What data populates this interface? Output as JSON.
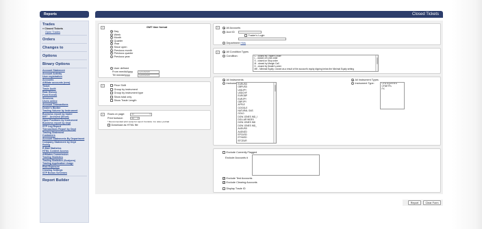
{
  "sidebar": {
    "header": "Reports",
    "trades": {
      "title": "Trades",
      "closed": "Closed Tickets",
      "open": "Open Trades"
    },
    "sections": [
      "Orders",
      "Changes to",
      "Options",
      "Binary Options"
    ],
    "items": [
      "Account Statement",
      "Account Activity",
      "User registration",
      "Accounts",
      "Affiliate accounts (new)",
      "Ticket",
      "Trade Audit",
      "Rate History",
      "Feed Events",
      "Sessions",
      "Users online",
      "Account Transactions",
      "Dealer's Blotter",
      "Trading Volume by Instrument",
      "Business report by trader",
      "BRT - Archived (Short)",
      "Open Positions by Instrument",
      "Business report by dept",
      "STP Log Report",
      "Transactions Report by Dept",
      "Trading Statement",
      "Customers",
      "Account Statements By Department",
      "Company Statement by Dept",
      "Rating",
      "E-Mail Statistics",
      "HTML Content Access",
      "Affiliates Commission",
      "Trading Statistics",
      "Trading Statistics (Scalpers)",
      "Trading Application Usage",
      "Risk Exposure",
      "Clearing Settings",
      "STP Bonus Schemes"
    ],
    "footer_section": "Report Builder"
  },
  "title": "Closed Tickets",
  "time_panel": {
    "heading": "GMT time format",
    "options": [
      "Day",
      "Week",
      "Month",
      "Quarter",
      "Year",
      "Since open",
      "Previous month",
      "Previous quarter",
      "Previous year"
    ],
    "user_defined": "User defined",
    "from_label": "From mm/dd/yyyy",
    "from_value": "12/13/2020",
    "till_label": "Till mm/dd/yyyy",
    "till_value": "12/20/2020"
  },
  "group_panel": {
    "options": [
      "Price Shift",
      "Group by instrument",
      "Group by instrument type",
      "Show total only",
      "Show Trade Length"
    ]
  },
  "rows_panel": {
    "rows_label": "Rows on page:",
    "rows_value": "30",
    "font_label": "Print fontsize:",
    "font_value": "30",
    "note": "* Recommended print setup for report: Fontsize: 12, letter, portrait",
    "download": "Download as HTML file"
  },
  "accounts_panel": {
    "all": "All Accounts",
    "acct_id": "Acct ID",
    "trader_login": "Trader's Login",
    "department": "Department",
    "department_link": "Hlds"
  },
  "condition_panel": {
    "all": "All Condition Types",
    "condition": "Condition:",
    "items": [
      "C - closed by Trader's order",
      "L - closed on Limit order",
      "S - closed on Stop order",
      "M - closed by Margin Call",
      "D - closed by Dealer's order",
      "ME - Minimal Equity. Closed as a result of the account's equity dipping below the Minimal Equity setting"
    ]
  },
  "instrument_panel": {
    "all": "All Instruments",
    "instrument": "Instrument:",
    "items": [
      "EURUSD",
      "GBPUSD",
      "USDJPY",
      "USDCHF",
      "EURGBP",
      "EURJPY",
      "GBPJPY",
      "APPLE",
      "GOOGLE",
      "NATURAL GAS",
      "GOLD",
      "DOW JONES IND_I",
      "DOLLAR INDEX",
      "DOW JONES IND",
      "DOW JONES IND_",
      "AUDUSD",
      "AUDNZD",
      "EPCUSD",
      "ETHUSD",
      "BTCEUR"
    ],
    "all_types": "All Instrument Types",
    "type_label": "Instrument Type:",
    "types": [
      "CFD EQUITIES",
      "CFDETFs",
      "FX"
    ]
  },
  "exclude_panel": {
    "exclude_flagged": "Exclude Currently Flagged",
    "exclude_accounts": "Exclude Accounts #",
    "exclude_test": "Exclude Test Accounts",
    "exclude_clearing": "Exclude Clearing Accounts",
    "display_trade_id": "Display Trade ID"
  },
  "buttons": {
    "report": "Report",
    "clear": "Clear Form"
  }
}
